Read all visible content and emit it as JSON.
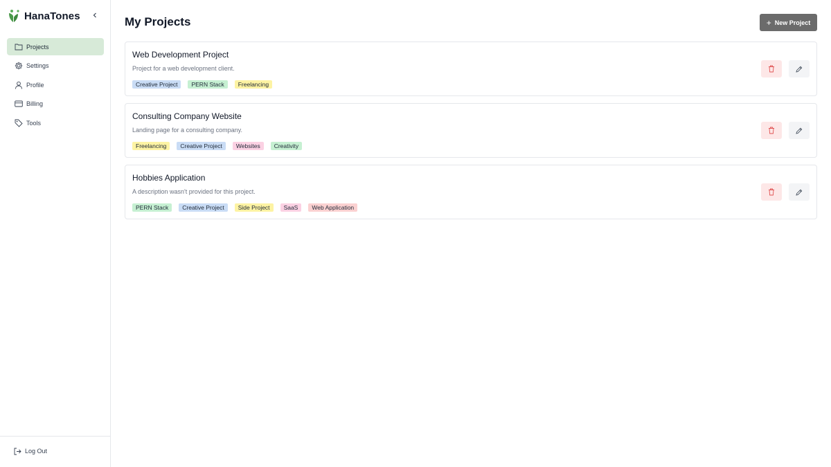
{
  "app": {
    "name": "HanaTones",
    "brand_color": "#4a9a4a"
  },
  "sidebar": {
    "items": [
      {
        "label": "Projects",
        "icon": "folder-icon",
        "active": true
      },
      {
        "label": "Settings",
        "icon": "gear-icon",
        "active": false
      },
      {
        "label": "Profile",
        "icon": "user-icon",
        "active": false
      },
      {
        "label": "Billing",
        "icon": "credit-card-icon",
        "active": false
      },
      {
        "label": "Tools",
        "icon": "tag-icon",
        "active": false
      }
    ],
    "logout_label": "Log Out"
  },
  "main": {
    "title": "My Projects",
    "new_button_label": "New Project"
  },
  "projects": [
    {
      "title": "Web Development Project",
      "description": "Project for a web development client.",
      "tags": [
        {
          "label": "Creative Project",
          "color": "#c9dcf5"
        },
        {
          "label": "PERN Stack",
          "color": "#c6f0d2"
        },
        {
          "label": "Freelancing",
          "color": "#fdf3a3"
        }
      ]
    },
    {
      "title": "Consulting Company Website",
      "description": "Landing page for a consulting company.",
      "tags": [
        {
          "label": "Freelancing",
          "color": "#fdf3a3"
        },
        {
          "label": "Creative Project",
          "color": "#c9dcf5"
        },
        {
          "label": "Websites",
          "color": "#fbd1e3"
        },
        {
          "label": "Creativity",
          "color": "#c6f0d2"
        }
      ]
    },
    {
      "title": "Hobbies Application",
      "description": "A description wasn't provided for this project.",
      "tags": [
        {
          "label": "PERN Stack",
          "color": "#c6f0d2"
        },
        {
          "label": "Creative Project",
          "color": "#c9dcf5"
        },
        {
          "label": "Side Project",
          "color": "#fdf3a3"
        },
        {
          "label": "SaaS",
          "color": "#fbd1e3"
        },
        {
          "label": "Web Application",
          "color": "#fbd1d1"
        }
      ]
    }
  ],
  "colors": {
    "active_nav": "#d7ead8",
    "delete_bg": "#fde7e7",
    "delete_icon": "#e05252",
    "edit_bg": "#f3f4f6",
    "primary_button": "#6b6b6b"
  }
}
